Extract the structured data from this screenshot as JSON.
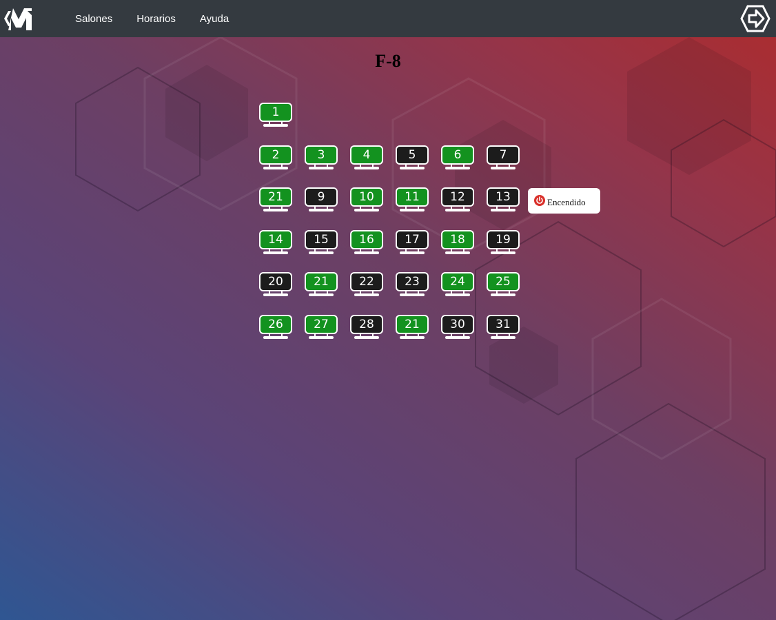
{
  "navbar": {
    "links": [
      "Salones",
      "Horarios",
      "Ayuda"
    ]
  },
  "room": {
    "title": "F-8"
  },
  "computers": {
    "rows": [
      [
        {
          "n": "1",
          "status": "on"
        }
      ],
      [
        {
          "n": "2",
          "status": "on"
        },
        {
          "n": "3",
          "status": "on"
        },
        {
          "n": "4",
          "status": "on"
        },
        {
          "n": "5",
          "status": "off"
        },
        {
          "n": "6",
          "status": "on"
        },
        {
          "n": "7",
          "status": "off"
        }
      ],
      [
        {
          "n": "21",
          "status": "on"
        },
        {
          "n": "9",
          "status": "off"
        },
        {
          "n": "10",
          "status": "on"
        },
        {
          "n": "11",
          "status": "on"
        },
        {
          "n": "12",
          "status": "off"
        },
        {
          "n": "13",
          "status": "off"
        }
      ],
      [
        {
          "n": "14",
          "status": "on"
        },
        {
          "n": "15",
          "status": "off"
        },
        {
          "n": "16",
          "status": "on"
        },
        {
          "n": "17",
          "status": "off"
        },
        {
          "n": "18",
          "status": "on"
        },
        {
          "n": "19",
          "status": "off"
        }
      ],
      [
        {
          "n": "20",
          "status": "off"
        },
        {
          "n": "21",
          "status": "on"
        },
        {
          "n": "22",
          "status": "off"
        },
        {
          "n": "23",
          "status": "off"
        },
        {
          "n": "24",
          "status": "on"
        },
        {
          "n": "25",
          "status": "on"
        }
      ],
      [
        {
          "n": "26",
          "status": "on"
        },
        {
          "n": "27",
          "status": "on"
        },
        {
          "n": "28",
          "status": "off"
        },
        {
          "n": "21",
          "status": "on"
        },
        {
          "n": "30",
          "status": "off"
        },
        {
          "n": "31",
          "status": "off"
        }
      ]
    ]
  },
  "tooltip": {
    "label": "Encendido",
    "icon": "power-icon"
  },
  "colors": {
    "on": "#13921f",
    "off": "#1c1c1c",
    "navbar": "#343a40",
    "power": "#d9302a"
  }
}
